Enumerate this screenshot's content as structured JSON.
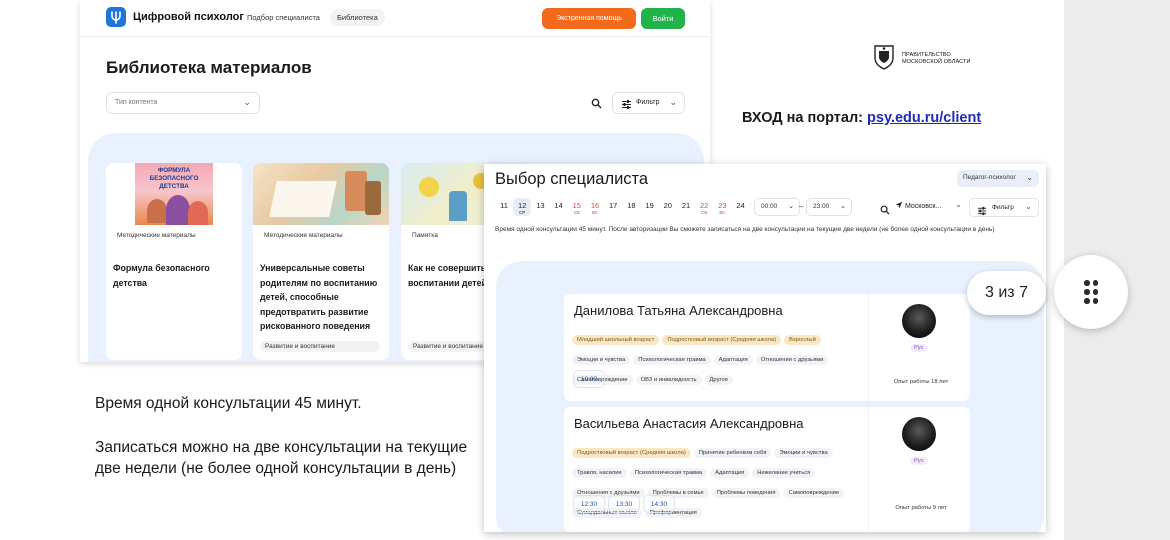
{
  "library": {
    "brand": "Цифровой психолог",
    "nav": [
      "Подбор специалиста",
      "Библиотека"
    ],
    "emergency_label": "Экстренная помощь",
    "login_label": "Войти",
    "title": "Библиотека материалов",
    "content_type_placeholder": "Тип контента",
    "filter_label": "Фильтр",
    "cards": [
      {
        "tag": "Методические материалы",
        "title": "Формула безопасного детства",
        "footer": ""
      },
      {
        "tag": "Методические материалы",
        "title": "Универсальные советы родителям по воспитанию детей, способные предотвратить развитие рискованного поведения",
        "footer": "Развитие и воспитание"
      },
      {
        "tag": "Памятка",
        "title": "Как не совершить ошибки в воспитании детей",
        "footer": "Развитие и воспитание"
      }
    ],
    "book_cover_text": "ФОРМУЛА БЕЗОПАСНОГО ДЕТСТВА"
  },
  "gov": {
    "line1": "ПРАВИТЕЛЬСТВО",
    "line2": "МОСКОВСКОЙ ОБЛАСТИ"
  },
  "portal": {
    "prefix": "ВХОД на портал: ",
    "link": "psy.edu.ru/client"
  },
  "info": {
    "line1": "Время одной консультации 45 минут.",
    "line2": "Записаться можно на две консультации на текущие",
    "line3": "две недели (не более одной консультации в день)"
  },
  "specialist": {
    "title": "Выбор специалиста",
    "role": "Педагог-психолог",
    "days": [
      {
        "n": "11",
        "sub": "",
        "red": false,
        "sel": false
      },
      {
        "n": "12",
        "sub": "СР",
        "red": false,
        "sel": true
      },
      {
        "n": "13",
        "sub": "",
        "red": false,
        "sel": false
      },
      {
        "n": "14",
        "sub": "",
        "red": false,
        "sel": false
      },
      {
        "n": "15",
        "sub": "СБ",
        "red": true,
        "sel": false
      },
      {
        "n": "16",
        "sub": "ВС",
        "red": true,
        "sel": false
      },
      {
        "n": "17",
        "sub": "",
        "red": false,
        "sel": false
      },
      {
        "n": "18",
        "sub": "",
        "red": false,
        "sel": false
      },
      {
        "n": "19",
        "sub": "",
        "red": false,
        "sel": false
      },
      {
        "n": "20",
        "sub": "",
        "red": false,
        "sel": false
      },
      {
        "n": "21",
        "sub": "",
        "red": false,
        "sel": false
      },
      {
        "n": "22",
        "sub": "СБ",
        "red": true,
        "sel": false
      },
      {
        "n": "23",
        "sub": "ВС",
        "red": true,
        "sel": false
      },
      {
        "n": "24",
        "sub": "",
        "red": false,
        "sel": false
      }
    ],
    "time_from": "00:00",
    "time_to": "23:00",
    "time_dash": "–",
    "location": "Московск...",
    "filter_label": "Фильтр",
    "note": "Время одной консультации 45 минут. После авторизации Вы сможете записаться на две консультации на текущие две недели (не более одной консультации в день)",
    "cards": [
      {
        "name": "Данилова Татьяна Александровна",
        "chips_yellow": [
          "Младший школьный возраст",
          "Подростковый возраст (Средняя школа)",
          "Взрослый"
        ],
        "chips": [
          "Эмоции и чувства",
          "Психологическая травма",
          "Адаптация",
          "Отношения с друзьями",
          "Самоповреждение",
          "ОВЗ и инвалидность",
          "Другое"
        ],
        "slots": [
          "10:00"
        ],
        "lang": "Рус",
        "experience": "Опыт работы 18 лет"
      },
      {
        "name": "Васильева Анастасия Александровна",
        "chips_yellow": [
          "Подростковый возраст (Средняя школа)"
        ],
        "chips": [
          "Принятие ребенком себя",
          "Эмоции и чувства",
          "Травля, насилие",
          "Психологическая травма",
          "Адаптация",
          "Нежелание учиться",
          "Отношения с друзьями",
          "Проблемы в семье",
          "Проблемы поведения",
          "Самоповреждение",
          "Суицидальные мысли",
          "Профориентация"
        ],
        "slots": [
          "12:30",
          "13:30",
          "14:30"
        ],
        "lang": "Рус",
        "experience": "Опыт работы 9 лет"
      }
    ]
  },
  "pager": "3 из 7",
  "colors": {
    "brand_blue": "#1e74d8",
    "emergency": "#f26a1b",
    "login": "#1fb34a",
    "card_bg": "#e8f1fd",
    "link": "#1f2bb8"
  }
}
